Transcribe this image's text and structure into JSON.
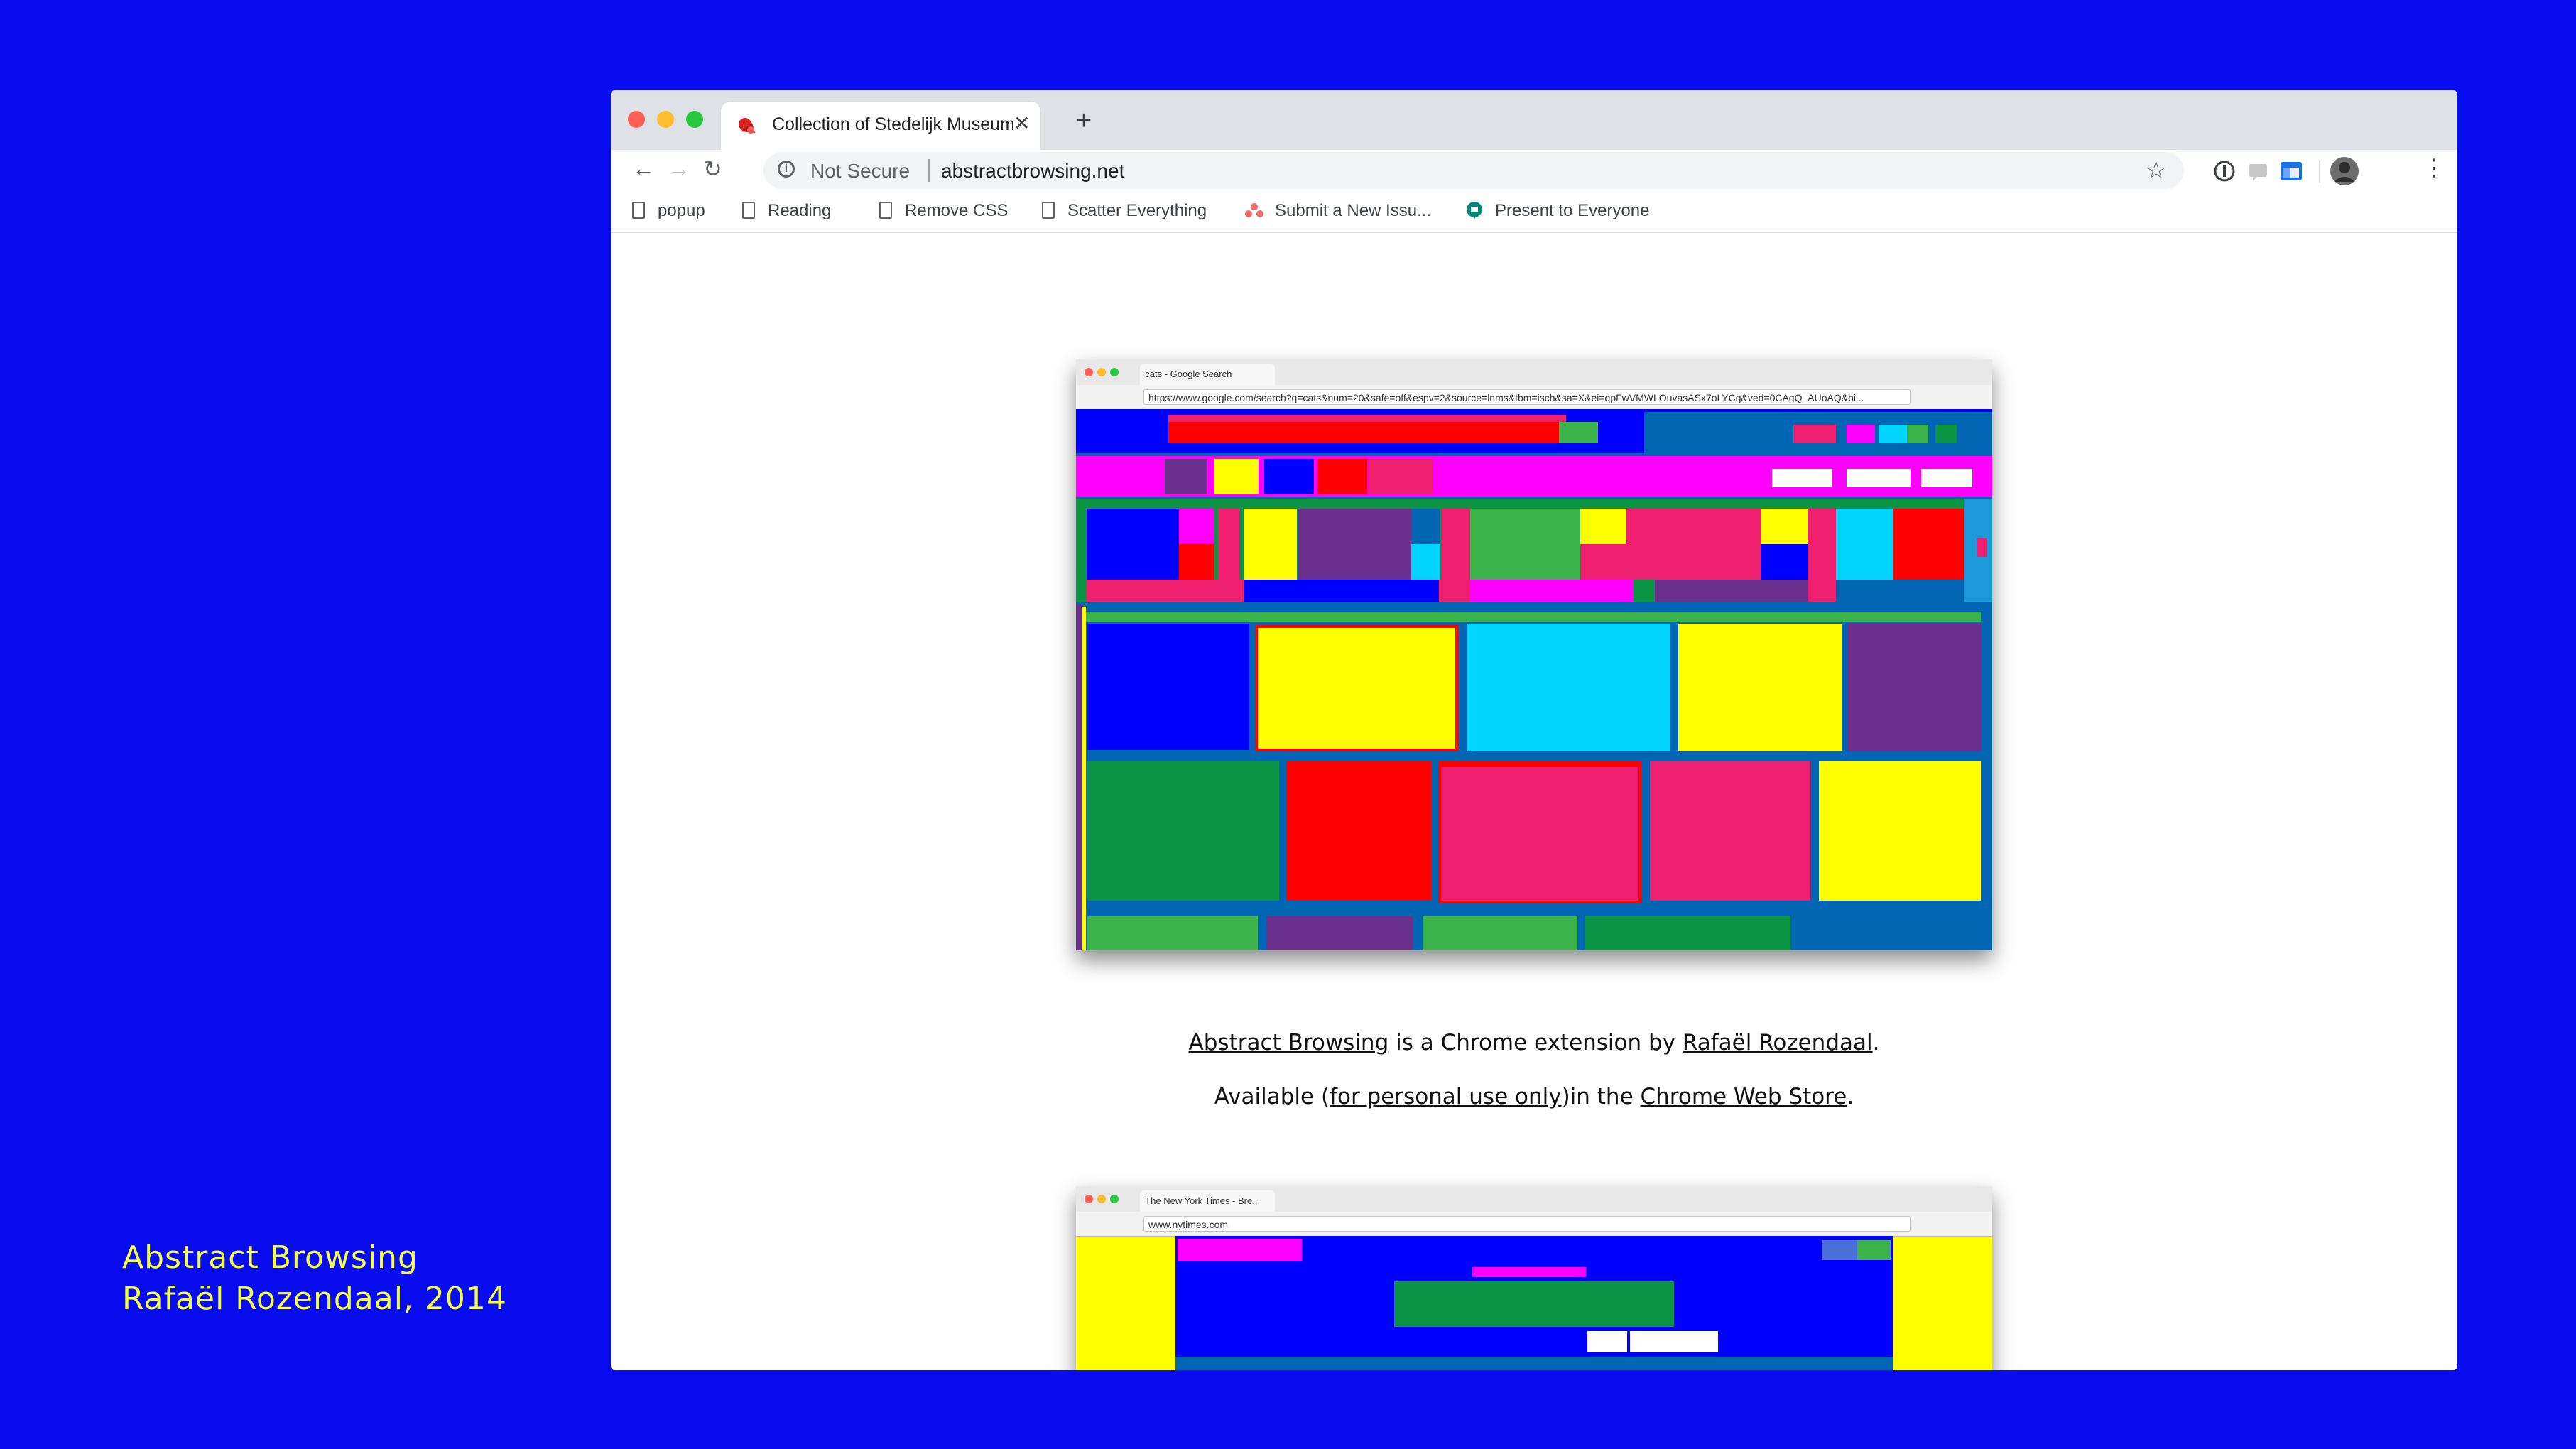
{
  "caption": {
    "line1": "Abstract Browsing",
    "line2": "Rafaël Rozendaal, 2014"
  },
  "browser": {
    "tab_title": "Collection of Stedelijk Museum",
    "new_tab_label": "+",
    "security_label": "Not Secure",
    "url": "abstractbrowsing.net",
    "bookmarks": [
      {
        "label": "popup",
        "icon": "page-icon"
      },
      {
        "label": "Reading",
        "icon": "page-icon"
      },
      {
        "label": "Remove CSS",
        "icon": "page-icon"
      },
      {
        "label": "Scatter Everything",
        "icon": "page-icon"
      },
      {
        "label": "Submit a New Issu...",
        "icon": "asana-icon"
      },
      {
        "label": "Present to Everyone",
        "icon": "present-icon"
      }
    ]
  },
  "screenshot1": {
    "tab_title": "cats - Google Search",
    "url": "https://www.google.com/search?q=cats&num=20&safe=off&espv=2&source=lnms&tbm=isch&sa=X&ei=qpFwVMWLOuvasASx7oLYCg&ved=0CAgQ_AUoAQ&bi..."
  },
  "description": {
    "link1": "Abstract Browsing",
    "text1": " is a Chrome extension by ",
    "link2": "Rafaël Rozendaal",
    "text2": ".",
    "text3": "Available (",
    "link3": "for personal use only",
    "text4": ")in the ",
    "link4": "Chrome Web Store",
    "text5": "."
  },
  "screenshot2": {
    "tab_title": "The New York Times - Bre...",
    "url": "www.nytimes.com"
  },
  "colors": {
    "background": "#0a0cf0",
    "caption": "#f2ff45",
    "blue": "#0000ff",
    "yellow": "#ffff00",
    "cyan": "#00d4ff",
    "magenta": "#ff00ff",
    "red": "#ff0000",
    "pink": "#ee1f6e",
    "purple": "#6b2f8e",
    "green": "#0b9444",
    "lightgreen": "#3ab44a",
    "steelblue": "#0066b3"
  }
}
